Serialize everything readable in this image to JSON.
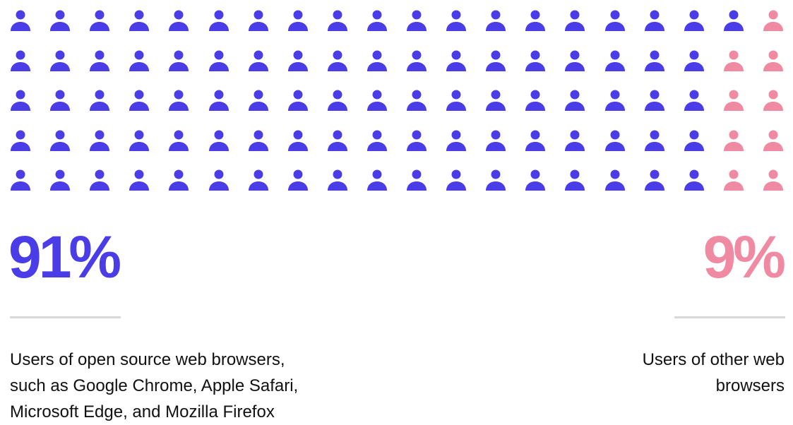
{
  "colors": {
    "open_source": "#4a3de8",
    "other": "#f08aa3"
  },
  "icon_name": "person-icon",
  "chart_data": {
    "type": "waffle",
    "rows": 5,
    "columns": 20,
    "series": [
      {
        "value": 91,
        "color": "#4a3de8"
      },
      {
        "value": 9,
        "color": "#f08aa3"
      }
    ]
  },
  "stats": {
    "left": {
      "percent": "91%",
      "caption_lines": [
        "Users of open source web browsers,",
        "such as Google Chrome, Apple Safari,",
        "Microsoft Edge, and Mozilla Firefox"
      ]
    },
    "right": {
      "percent": "9%",
      "caption_lines": [
        "Users of other web",
        "browsers"
      ]
    }
  }
}
